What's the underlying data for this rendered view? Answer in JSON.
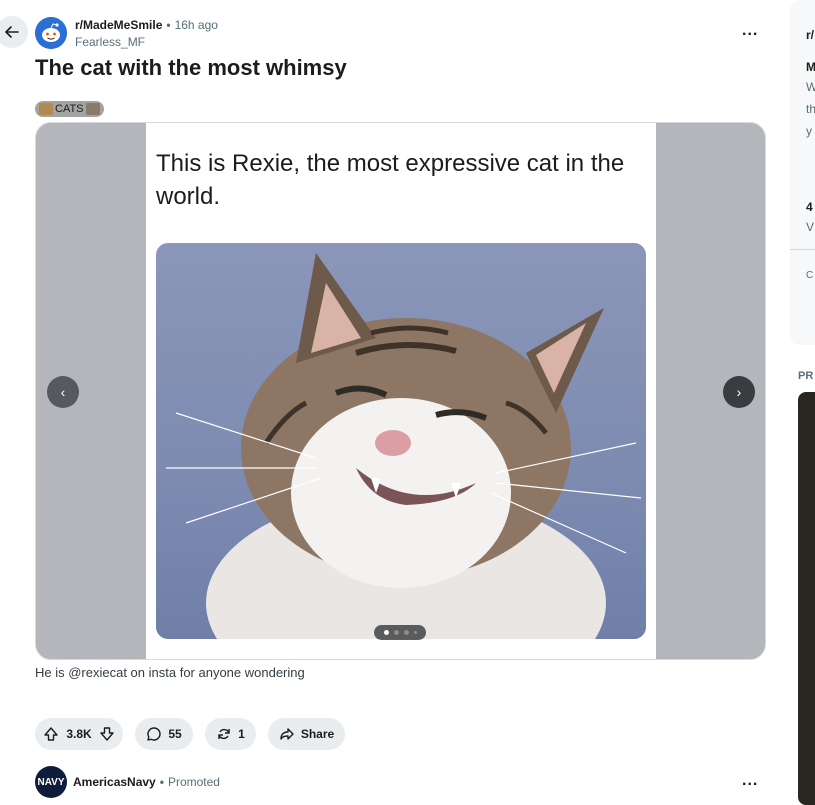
{
  "post": {
    "subreddit": "r/MadeMeSmile",
    "time": "16h ago",
    "author": "Fearless_MF",
    "title": "The cat with the most whimsy",
    "flair": "CATS",
    "body": "He is @rexiecat on insta for anyone wondering",
    "more_label": "..."
  },
  "gallery": {
    "caption": "This is Rexie, the most expressive cat in the world.",
    "slide_count": 4,
    "current_slide": 1,
    "prev_label": "‹",
    "next_label": "›"
  },
  "actions": {
    "upvotes": "3.8K",
    "comments": "55",
    "awards": "1",
    "share": "Share"
  },
  "promoted": {
    "avatar_text": "NAVY",
    "name": "AmericasNavy",
    "label": "Promoted",
    "more_label": "..."
  },
  "sidebar": {
    "lines": [
      "r/",
      "M",
      "W",
      "th",
      "y",
      "4",
      "V",
      "C"
    ],
    "section_label": "PR"
  },
  "colors": {
    "action_bg": "#eaedef",
    "muted_text": "#576f76",
    "photo_bg": "#7d8bb1"
  }
}
